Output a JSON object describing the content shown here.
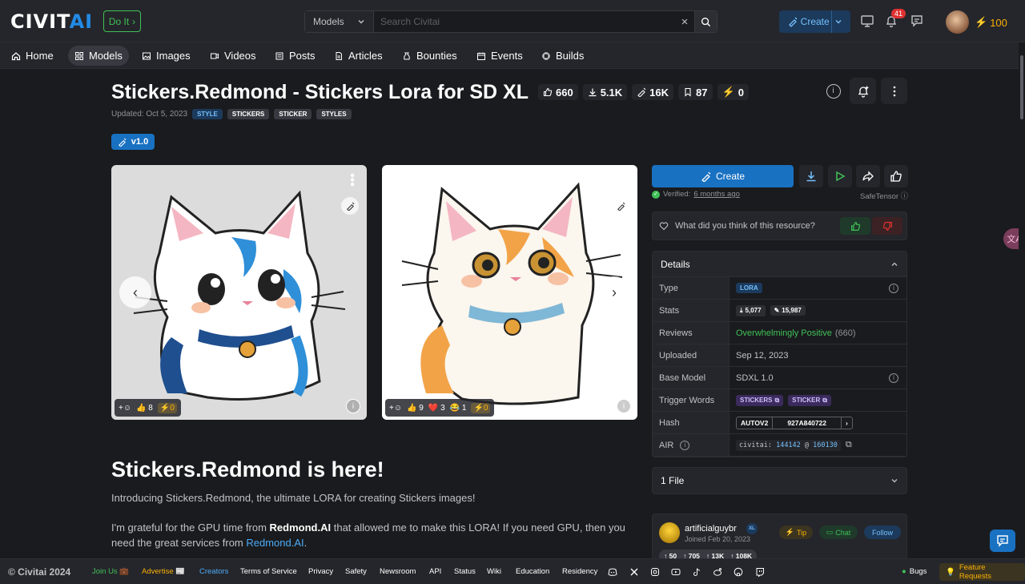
{
  "header": {
    "logo_text": "CIVIT",
    "logo_accent": "AI",
    "doit_label": "Do It",
    "search_type": "Models",
    "search_placeholder": "Search Civitai",
    "create_label": "Create",
    "notifications_count": "41",
    "buzz_balance": "100"
  },
  "nav": {
    "items": [
      {
        "label": "Home"
      },
      {
        "label": "Models"
      },
      {
        "label": "Images"
      },
      {
        "label": "Videos"
      },
      {
        "label": "Posts"
      },
      {
        "label": "Articles"
      },
      {
        "label": "Bounties"
      },
      {
        "label": "Events"
      },
      {
        "label": "Builds"
      }
    ]
  },
  "model": {
    "title": "Stickers.Redmond - Stickers Lora for SD XL",
    "stats": {
      "likes": "660",
      "downloads": "5.1K",
      "generations": "16K",
      "bookmarks": "87",
      "buzz": "0"
    },
    "updated": "Updated: Oct 5, 2023",
    "tags": [
      "STYLE",
      "STICKERS",
      "STICKER",
      "STYLES"
    ],
    "version": "v1.0"
  },
  "gallery": {
    "card1": {
      "likes": "8",
      "buzz": "0"
    },
    "card2": {
      "likes": "9",
      "hearts": "3",
      "laughs": "1",
      "buzz": "0"
    }
  },
  "description": {
    "heading": "Stickers.Redmond is here!",
    "intro": "Introducing Stickers.Redmond, the ultimate LORA for creating Stickers images!",
    "p2_a": "I'm grateful for the GPU time from ",
    "p2_bold": "Redmond.AI",
    "p2_b": " that allowed me to make this LORA! If you need GPU, then you need the great services from ",
    "p2_link": "Redmond.AI",
    "p2_end": "."
  },
  "sidebar": {
    "create_label": "Create",
    "verified_label": "Verified:",
    "verified_when": "6 months ago",
    "safetensor": "SafeTensor",
    "feedback_question": "What did you think of this resource?",
    "details_title": "Details",
    "details": {
      "type_label": "Type",
      "type_value": "LORA",
      "stats_label": "Stats",
      "stats_downloads": "5,077",
      "stats_generations": "15,987",
      "reviews_label": "Reviews",
      "reviews_value": "Overwhelmingly Positive",
      "reviews_count": "(660)",
      "uploaded_label": "Uploaded",
      "uploaded_value": "Sep 12, 2023",
      "base_label": "Base Model",
      "base_value": "SDXL 1.0",
      "trigger_label": "Trigger Words",
      "trigger_1": "STICKERS",
      "trigger_2": "STICKER",
      "hash_label": "Hash",
      "hash_type": "AUTOV2",
      "hash_value": "927A840722",
      "air_label": "AIR",
      "air_prefix": "civitai:",
      "air_model": "144142",
      "air_at": "@",
      "air_version": "160130"
    },
    "files_label": "1 File",
    "creator": {
      "name": "artificialguybr",
      "joined": "Joined Feb 20, 2023",
      "badge": "XL",
      "tip_label": "Tip",
      "chat_label": "Chat",
      "follow_label": "Follow",
      "stat_1": "50",
      "stat_2": "705",
      "stat_3": "13K",
      "stat_4": "108K"
    }
  },
  "footer": {
    "copyright": "© Civitai 2024",
    "links": [
      "Join Us",
      "Advertise",
      "Creators",
      "Terms of Service",
      "Privacy",
      "Safety",
      "Newsroom",
      "API",
      "Status",
      "Wiki",
      "Education",
      "Residency"
    ],
    "bugs_label": "Bugs",
    "feature_label": "Feature Requests"
  },
  "colors": {
    "accent": "#1971c2",
    "success": "#40c057",
    "buzz": "#fab005",
    "background": "#1a1b1e",
    "surface": "#25262b"
  }
}
